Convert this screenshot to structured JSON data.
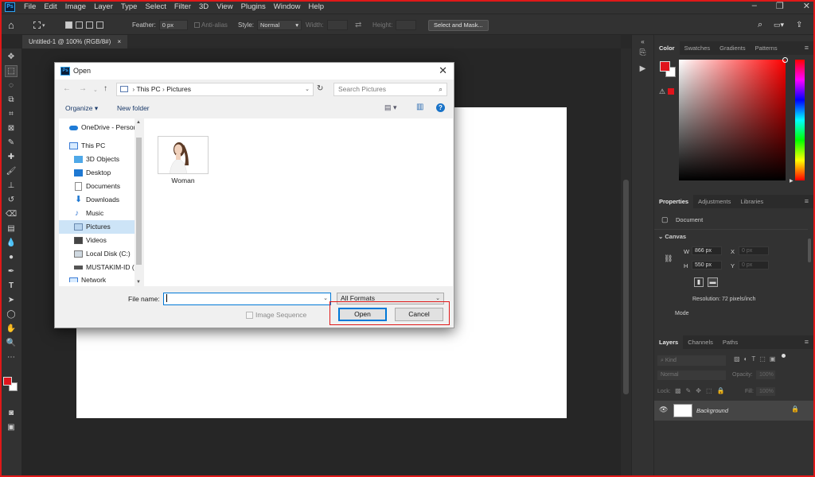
{
  "app": {
    "logo": "Ps",
    "menu": [
      "File",
      "Edit",
      "Image",
      "Layer",
      "Type",
      "Select",
      "Filter",
      "3D",
      "View",
      "Plugins",
      "Window",
      "Help"
    ]
  },
  "options": {
    "feather_label": "Feather:",
    "feather_value": "0 px",
    "antialias_label": "Anti-alias",
    "style_label": "Style:",
    "style_value": "Normal",
    "width_label": "Width:",
    "height_label": "Height:",
    "select_mask_button": "Select and Mask..."
  },
  "document_tab": {
    "title": "Untitled-1 @ 100% (RGB/8#)",
    "close": "×"
  },
  "panels": {
    "color_tabs": [
      "Color",
      "Swatches",
      "Gradients",
      "Patterns"
    ],
    "properties_tabs": [
      "Properties",
      "Adjustments",
      "Libraries"
    ],
    "properties_type": "Document",
    "canvas_header": "Canvas",
    "w_label": "W",
    "w_value": "866 px",
    "h_label": "H",
    "h_value": "550 px",
    "x_label": "X",
    "x_value": "0 px",
    "y_label": "Y",
    "y_value": "0 px",
    "resolution": "Resolution: 72 pixels/inch",
    "mode_label": "Mode",
    "layers_tabs": [
      "Layers",
      "Channels",
      "Paths"
    ],
    "layers_kind": "Kind",
    "blend_mode": "Normal",
    "opacity_label": "Opacity:",
    "opacity_value": "100%",
    "lock_label": "Lock:",
    "fill_label": "Fill:",
    "fill_value": "100%",
    "layer_name": "Background",
    "colors": {
      "foreground": "#e0141c",
      "background": "#ffffff"
    }
  },
  "dialog": {
    "title": "Open",
    "path": [
      "This PC",
      "Pictures"
    ],
    "search_placeholder": "Search Pictures",
    "organize_label": "Organize ▾",
    "new_folder_label": "New folder",
    "nav_items": [
      "OneDrive - Person",
      "This PC",
      "3D Objects",
      "Desktop",
      "Documents",
      "Downloads",
      "Music",
      "Pictures",
      "Videos",
      "Local Disk (C:)",
      "MUSTAKIM-ID (D",
      "Network"
    ],
    "selected_nav": "Pictures",
    "files": [
      {
        "name": "Woman"
      }
    ],
    "file_name_label": "File name:",
    "file_name_value": "",
    "format_value": "All Formats",
    "image_sequence_label": "Image Sequence",
    "open_button": "Open",
    "cancel_button": "Cancel"
  }
}
